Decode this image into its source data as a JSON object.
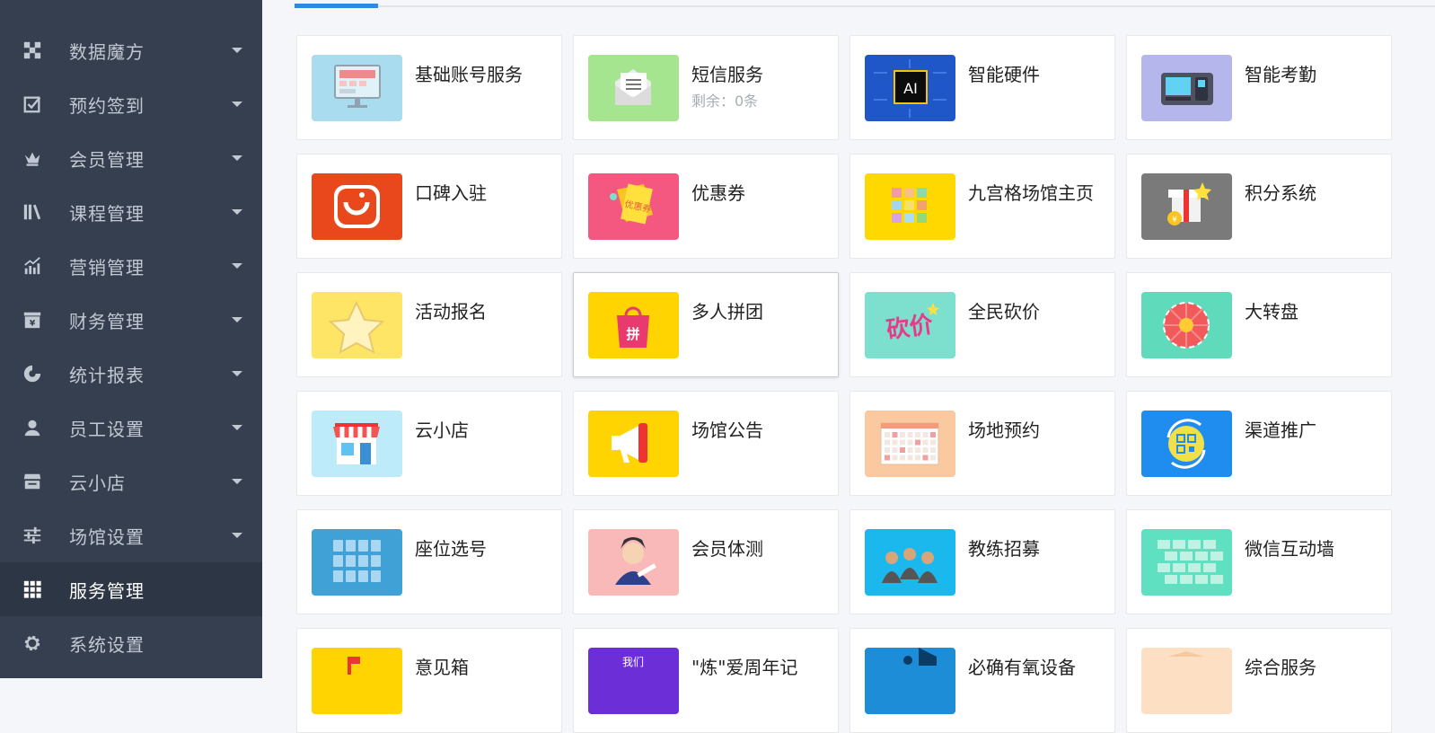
{
  "sidebar": {
    "items": [
      {
        "label": "数据魔方",
        "icon": "cube-icon",
        "expandable": true
      },
      {
        "label": "预约签到",
        "icon": "checkbox-icon",
        "expandable": true
      },
      {
        "label": "会员管理",
        "icon": "crown-icon",
        "expandable": true
      },
      {
        "label": "课程管理",
        "icon": "books-icon",
        "expandable": true
      },
      {
        "label": "营销管理",
        "icon": "chart-growth-icon",
        "expandable": true
      },
      {
        "label": "财务管理",
        "icon": "yen-box-icon",
        "expandable": true
      },
      {
        "label": "统计报表",
        "icon": "pie-chart-icon",
        "expandable": true
      },
      {
        "label": "员工设置",
        "icon": "user-icon",
        "expandable": true
      },
      {
        "label": "云小店",
        "icon": "store-icon",
        "expandable": true
      },
      {
        "label": "场馆设置",
        "icon": "sliders-icon",
        "expandable": true
      },
      {
        "label": "服务管理",
        "icon": "grid-icon",
        "expandable": false,
        "active": true
      },
      {
        "label": "系统设置",
        "icon": "gear-icon",
        "expandable": false
      }
    ]
  },
  "services": [
    {
      "title": "基础账号服务",
      "icon": "monitor-icon",
      "color": "#a9dcee"
    },
    {
      "title": "短信服务",
      "subtitle": "剩余：0条",
      "icon": "envelope-icon",
      "color": "#a5e58f"
    },
    {
      "title": "智能硬件",
      "icon": "ai-chip-icon",
      "color": "#1f56c8"
    },
    {
      "title": "智能考勤",
      "icon": "attendance-device-icon",
      "color": "#b4b6ec"
    },
    {
      "title": "口碑入驻",
      "icon": "koubei-logo-icon",
      "color": "#e8481c"
    },
    {
      "title": "优惠券",
      "icon": "coupon-icon",
      "color": "#f4577f"
    },
    {
      "title": "九宫格场馆主页",
      "icon": "nine-grid-icon",
      "color": "#ffd800"
    },
    {
      "title": "积分系统",
      "icon": "gift-icon",
      "color": "#7a7a7a"
    },
    {
      "title": "活动报名",
      "icon": "star-icon",
      "color": "#ffe566"
    },
    {
      "title": "多人拼团",
      "icon": "shopping-bag-icon",
      "color": "#ffd400"
    },
    {
      "title": "全民砍价",
      "icon": "bargain-icon",
      "color": "#7de0cf"
    },
    {
      "title": "大转盘",
      "icon": "wheel-icon",
      "color": "#5fdabb"
    },
    {
      "title": "云小店",
      "icon": "shop-icon",
      "color": "#bdebf9"
    },
    {
      "title": "场馆公告",
      "icon": "megaphone-icon",
      "color": "#ffd400"
    },
    {
      "title": "场地预约",
      "icon": "calendar-icon",
      "color": "#fbc9a0"
    },
    {
      "title": "渠道推广",
      "icon": "qrcode-refresh-icon",
      "color": "#1f8cf0"
    },
    {
      "title": "座位选号",
      "icon": "seats-icon",
      "color": "#3fa1d6"
    },
    {
      "title": "会员体测",
      "icon": "person-measure-icon",
      "color": "#f9b9b9"
    },
    {
      "title": "教练招募",
      "icon": "coaches-icon",
      "color": "#1bb8ee"
    },
    {
      "title": "微信互动墙",
      "icon": "brick-wall-icon",
      "color": "#5fe0c0"
    },
    {
      "title": "意见箱",
      "icon": "mailbox-icon",
      "color": "#ffd400"
    },
    {
      "title": "\"炼\"爱周年记",
      "icon": "anniversary-icon",
      "color": "#6c2ed6"
    },
    {
      "title": "必确有氧设备",
      "icon": "treadmill-icon",
      "color": "#1c8dd6"
    },
    {
      "title": "综合服务",
      "icon": "service-icon",
      "color": "#fde0c4"
    }
  ]
}
